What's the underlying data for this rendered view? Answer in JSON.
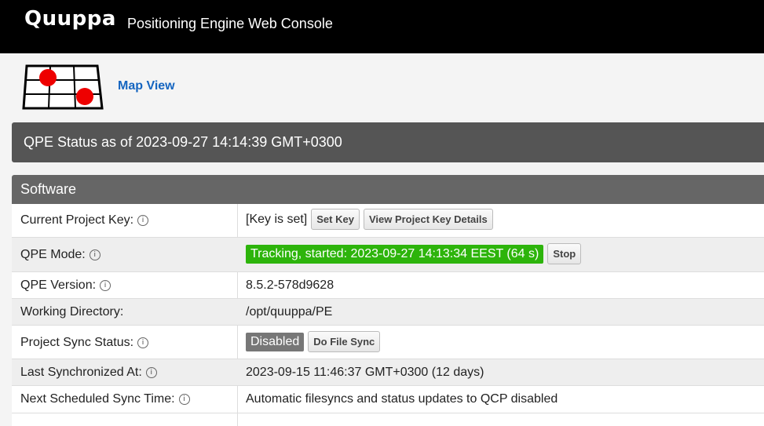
{
  "header": {
    "brand": "Quuppa",
    "title": "Positioning Engine Web Console"
  },
  "nav": {
    "map_view_label": "Map View"
  },
  "status": {
    "text": "QPE Status as of 2023-09-27 14:14:39 GMT+0300"
  },
  "software": {
    "section_title": "Software",
    "info_glyph": "i",
    "rows": {
      "project_key": {
        "label": "Current Project Key:",
        "value": "[Key is set]",
        "set_key_button": "Set Key",
        "view_details_button": "View Project Key Details"
      },
      "qpe_mode": {
        "label": "QPE Mode:",
        "value": "Tracking, started: 2023-09-27 14:13:34 EEST (64 s)",
        "stop_button": "Stop"
      },
      "qpe_version": {
        "label": "QPE Version:",
        "value": "8.5.2-578d9628"
      },
      "working_directory": {
        "label": "Working Directory:",
        "value": "/opt/quuppa/PE"
      },
      "project_sync_status": {
        "label": "Project Sync Status:",
        "value": "Disabled",
        "do_file_sync_button": "Do File Sync"
      },
      "last_synchronized": {
        "label": "Last Synchronized At:",
        "value": "2023-09-15 11:46:37 GMT+0300 (12 days)"
      },
      "next_sync": {
        "label": "Next Scheduled Sync Time:",
        "value": "Automatic filesyncs and status updates to QCP disabled"
      }
    }
  },
  "colors": {
    "tracking_badge": "#2db40b",
    "disabled_badge": "#777777",
    "link": "#1565c0"
  }
}
